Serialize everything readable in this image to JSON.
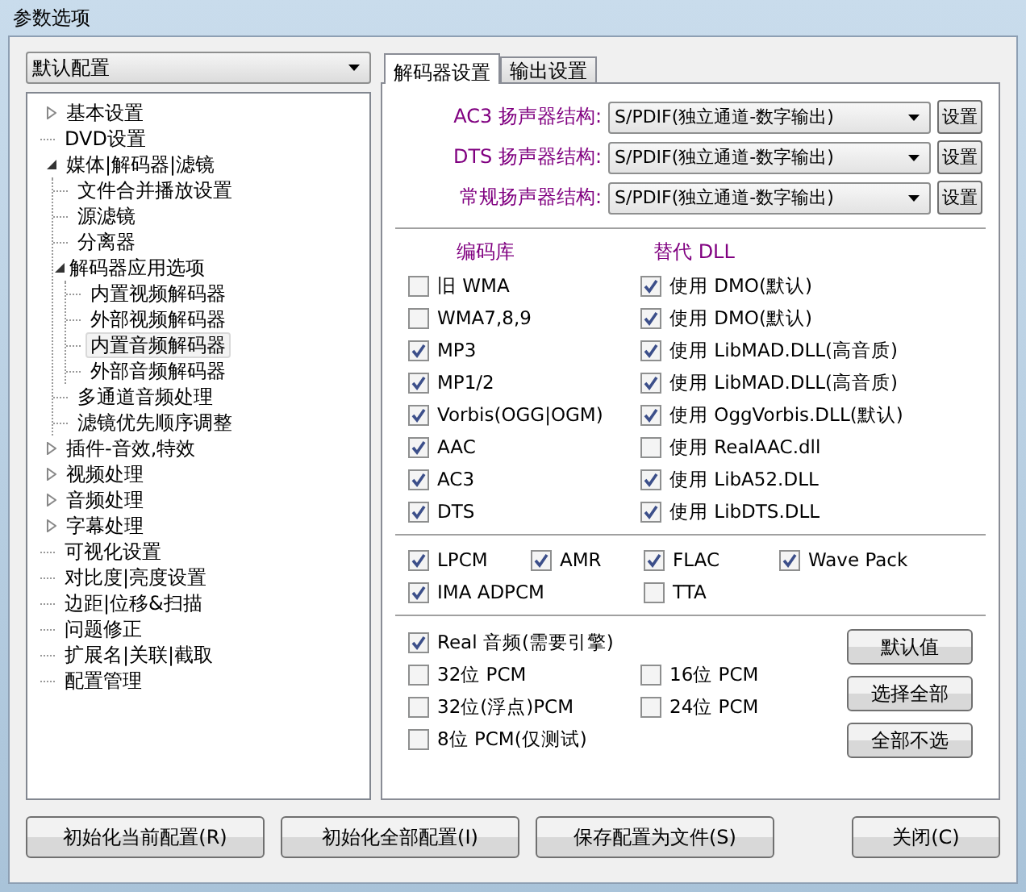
{
  "window": {
    "title": "参数选项"
  },
  "profile_select": {
    "value": "默认配置"
  },
  "tree": [
    {
      "label": "基本设置",
      "expanded": false,
      "selected": false
    },
    {
      "label": "DVD设置",
      "selected": false
    },
    {
      "label": "媒体|解码器|滤镜",
      "expanded": true,
      "selected": false,
      "children": [
        {
          "label": "文件合并播放设置",
          "selected": false
        },
        {
          "label": "源滤镜",
          "selected": false
        },
        {
          "label": "分离器",
          "selected": false
        },
        {
          "label": "解码器应用选项",
          "expanded": true,
          "selected": false,
          "children": [
            {
              "label": "内置视频解码器",
              "selected": false
            },
            {
              "label": "外部视频解码器",
              "selected": false
            },
            {
              "label": "内置音频解码器",
              "selected": true
            },
            {
              "label": "外部音频解码器",
              "selected": false
            }
          ]
        },
        {
          "label": "多通道音频处理",
          "selected": false
        },
        {
          "label": "滤镜优先顺序调整",
          "selected": false
        }
      ]
    },
    {
      "label": "插件-音效,特效",
      "expanded": false,
      "selected": false
    },
    {
      "label": "视频处理",
      "expanded": false,
      "selected": false
    },
    {
      "label": "音频处理",
      "expanded": false,
      "selected": false
    },
    {
      "label": "字幕处理",
      "expanded": false,
      "selected": false
    },
    {
      "label": "可视化设置",
      "selected": false
    },
    {
      "label": "对比度|亮度设置",
      "selected": false
    },
    {
      "label": "边距|位移&扫描",
      "selected": false
    },
    {
      "label": "问题修正",
      "selected": false
    },
    {
      "label": "扩展名|关联|截取",
      "selected": false
    },
    {
      "label": "配置管理",
      "selected": false
    }
  ],
  "tabs": [
    {
      "label": "解码器设置",
      "selected": true
    },
    {
      "label": "输出设置",
      "selected": false
    }
  ],
  "speakers": [
    {
      "label": "AC3 扬声器结构:",
      "value": "S/PDIF(独立通道-数字输出)",
      "button": "设置"
    },
    {
      "label": "DTS 扬声器结构:",
      "value": "S/PDIF(独立通道-数字输出)",
      "button": "设置"
    },
    {
      "label": "常规扬声器结构:",
      "value": "S/PDIF(独立通道-数字输出)",
      "button": "设置"
    }
  ],
  "codec_heading": "编码库",
  "dll_heading": "替代 DLL",
  "codecs": [
    {
      "codec": {
        "label": "旧 WMA",
        "checked": false
      },
      "dll": {
        "label": "使用 DMO(默认)",
        "checked": true
      }
    },
    {
      "codec": {
        "label": "WMA7,8,9",
        "checked": false
      },
      "dll": {
        "label": "使用 DMO(默认)",
        "checked": true
      }
    },
    {
      "codec": {
        "label": "MP3",
        "checked": true
      },
      "dll": {
        "label": "使用 LibMAD.DLL(高音质)",
        "checked": true
      }
    },
    {
      "codec": {
        "label": "MP1/2",
        "checked": true
      },
      "dll": {
        "label": "使用 LibMAD.DLL(高音质)",
        "checked": true
      }
    },
    {
      "codec": {
        "label": "Vorbis(OGG|OGM)",
        "checked": true
      },
      "dll": {
        "label": "使用 OggVorbis.DLL(默认)",
        "checked": true
      }
    },
    {
      "codec": {
        "label": "AAC",
        "checked": true
      },
      "dll": {
        "label": "使用 RealAAC.dll",
        "checked": false
      }
    },
    {
      "codec": {
        "label": "AC3",
        "checked": true
      },
      "dll": {
        "label": "使用 LibA52.DLL",
        "checked": true
      }
    },
    {
      "codec": {
        "label": "DTS",
        "checked": true
      },
      "dll": {
        "label": "使用 LibDTS.DLL",
        "checked": true
      }
    }
  ],
  "format_columns": [
    [
      {
        "label": "LPCM",
        "checked": true
      },
      {
        "label": "IMA ADPCM",
        "checked": true
      }
    ],
    [
      {
        "label": "AMR",
        "checked": true
      }
    ],
    [
      {
        "label": "FLAC",
        "checked": true
      },
      {
        "label": "TTA",
        "checked": false
      }
    ],
    [
      {
        "label": "Wave Pack",
        "checked": true
      }
    ]
  ],
  "pcm_rows": [
    [
      {
        "label": "Real 音频(需要引擎)",
        "checked": true
      }
    ],
    [
      {
        "label": "32位 PCM",
        "checked": false
      },
      {
        "label": "16位 PCM",
        "checked": false
      }
    ],
    [
      {
        "label": "32位(浮点)PCM",
        "checked": false
      },
      {
        "label": "24位 PCM",
        "checked": false
      }
    ],
    [
      {
        "label": "8位 PCM(仅测试)",
        "checked": false
      }
    ]
  ],
  "side_buttons": [
    "默认值",
    "选择全部",
    "全部不选"
  ],
  "bottom_buttons": [
    {
      "label": "初始化当前配置(R)"
    },
    {
      "label": "初始化全部配置(I)"
    },
    {
      "label": "保存配置为文件(S)"
    },
    {
      "label": "关闭(C)",
      "kind": "close"
    }
  ]
}
